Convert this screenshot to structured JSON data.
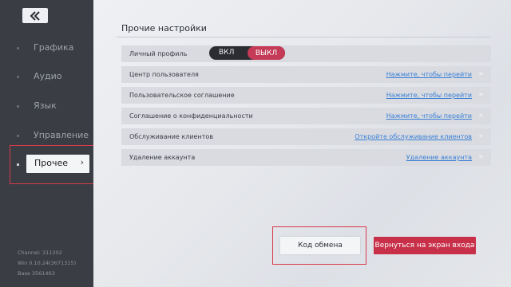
{
  "sidebar": {
    "back_icon": "back-arrow-icon",
    "items": [
      {
        "label": "Графика"
      },
      {
        "label": "Аудио"
      },
      {
        "label": "Язык"
      },
      {
        "label": "Управление"
      },
      {
        "label": "Прочее",
        "active": true
      }
    ],
    "active_chevron": "›",
    "version": {
      "channel": "Channel: 311302",
      "win": "Win 0.10.24(3671315)",
      "base": "Base 3561463"
    }
  },
  "main": {
    "section_title": "Прочие настройки",
    "profile_row": {
      "label": "Личный профиль",
      "toggle_on": "ВКЛ",
      "toggle_off": "ВЫКЛ",
      "selected": "ВЫКЛ"
    },
    "rows": [
      {
        "label": "Центр пользователя",
        "link": "Нажмите, чтобы перейти"
      },
      {
        "label": "Пользовательское соглашение",
        "link": "Нажмите, чтобы перейти"
      },
      {
        "label": "Соглашение о конфиденциальности",
        "link": "Нажмите, чтобы перейти"
      },
      {
        "label": "Обслуживание клиентов",
        "link": "Откройте обслуживание клиентов"
      },
      {
        "label": "Удаление аккаунта",
        "link": "Удаление аккаунта"
      }
    ],
    "row_arrow": "»",
    "code_button": "Код обмена",
    "return_button": "Вернуться на экран входа"
  },
  "colors": {
    "sidebar_bg": "#3a3d44",
    "accent_red": "#c8304a",
    "link_blue": "#3a7fd6",
    "highlight_box": "#d83a4a"
  }
}
